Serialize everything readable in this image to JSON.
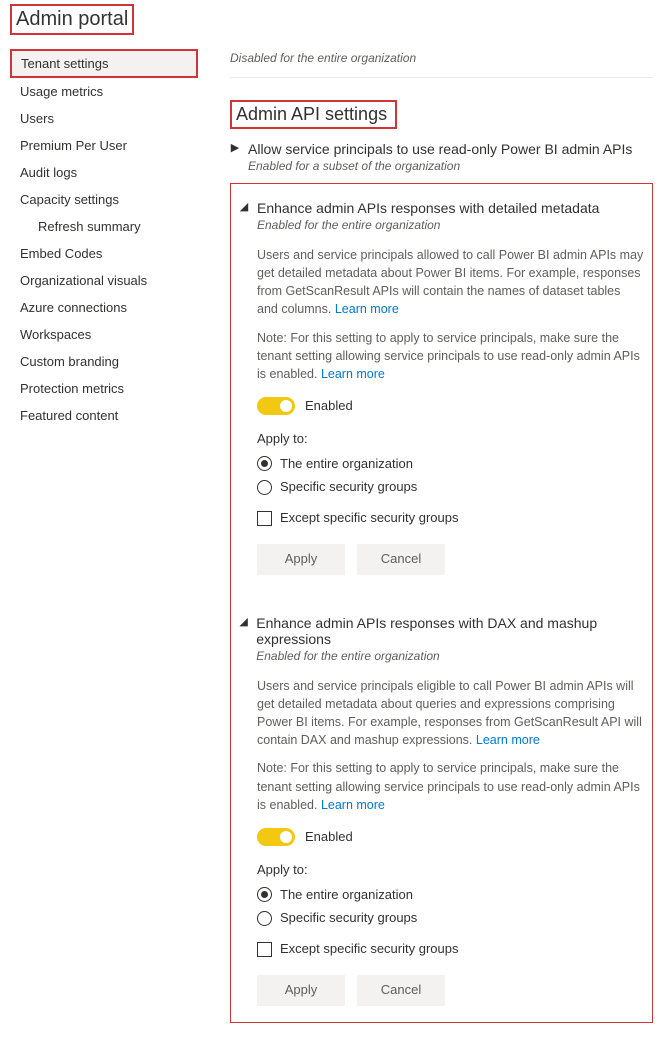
{
  "header": {
    "title": "Admin portal"
  },
  "sidebar": {
    "items": [
      {
        "label": "Tenant settings",
        "selected": true
      },
      {
        "label": "Usage metrics"
      },
      {
        "label": "Users"
      },
      {
        "label": "Premium Per User"
      },
      {
        "label": "Audit logs"
      },
      {
        "label": "Capacity settings"
      },
      {
        "label": "Refresh summary",
        "sub": true
      },
      {
        "label": "Embed Codes"
      },
      {
        "label": "Organizational visuals"
      },
      {
        "label": "Azure connections"
      },
      {
        "label": "Workspaces"
      },
      {
        "label": "Custom branding"
      },
      {
        "label": "Protection metrics"
      },
      {
        "label": "Featured content"
      }
    ]
  },
  "main": {
    "disabled_note": "Disabled for the entire organization",
    "section_title": "Admin API settings",
    "setting0": {
      "title": "Allow service principals to use read-only Power BI admin APIs",
      "subtitle": "Enabled for a subset of the organization"
    },
    "common": {
      "learn_more": "Learn more",
      "enabled_label": "Enabled",
      "apply_to": "Apply to:",
      "opt_entire": "The entire organization",
      "opt_specific": "Specific security groups",
      "except_label": "Except specific security groups",
      "apply_btn": "Apply",
      "cancel_btn": "Cancel"
    },
    "setting1": {
      "title": "Enhance admin APIs responses with detailed metadata",
      "subtitle": "Enabled for the entire organization",
      "desc": "Users and service principals allowed to call Power BI admin APIs may get detailed metadata about Power BI items. For example, responses from GetScanResult APIs will contain the names of dataset tables and columns.",
      "note": "Note: For this setting to apply to service principals, make sure the tenant setting allowing service principals to use read-only admin APIs is enabled."
    },
    "setting2": {
      "title": "Enhance admin APIs responses with DAX and mashup expressions",
      "subtitle": "Enabled for the entire organization",
      "desc": "Users and service principals eligible to call Power BI admin APIs will get detailed metadata about queries and expressions comprising Power BI items. For example, responses from GetScanResult API will contain DAX and mashup expressions.",
      "note": "Note: For this setting to apply to service principals, make sure the tenant setting allowing service principals to use read-only admin APIs is enabled."
    }
  }
}
